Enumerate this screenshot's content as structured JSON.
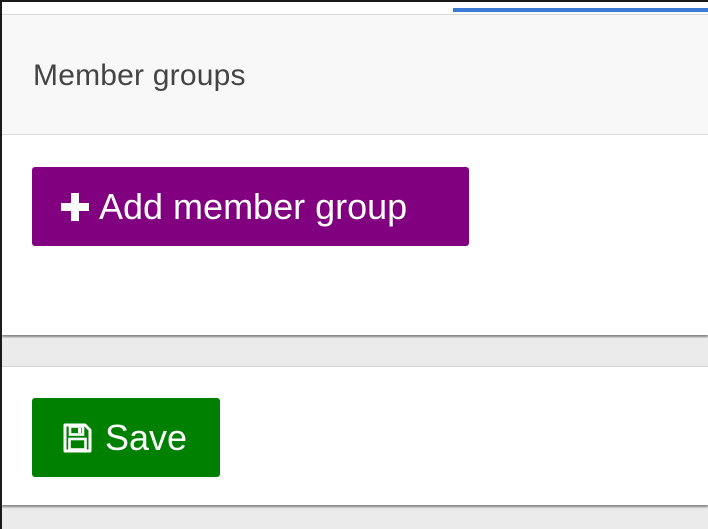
{
  "panel": {
    "title": "Member groups",
    "add_button_label": "Add member group",
    "add_button_icon": "plus-icon",
    "add_button_color": "#800080"
  },
  "footer": {
    "save_button_label": "Save",
    "save_button_icon": "floppy-disk-icon",
    "save_button_color": "#008000"
  },
  "colors": {
    "tab_accent": "#3c7ad6"
  }
}
